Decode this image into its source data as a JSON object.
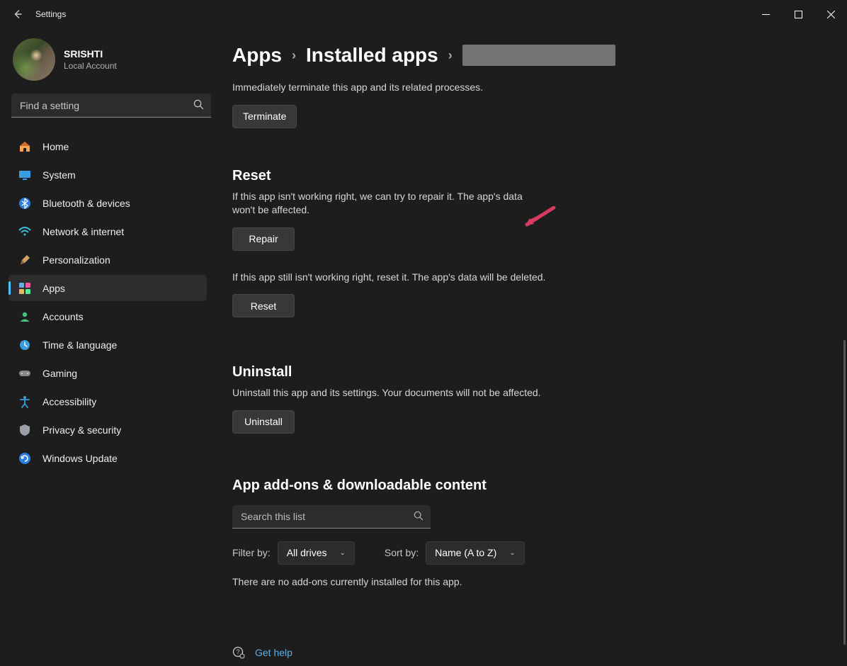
{
  "window": {
    "title": "Settings"
  },
  "profile": {
    "name": "SRISHTI",
    "account_type": "Local Account"
  },
  "search": {
    "placeholder": "Find a setting"
  },
  "nav": {
    "home": "Home",
    "system": "System",
    "bluetooth": "Bluetooth & devices",
    "network": "Network & internet",
    "personalization": "Personalization",
    "apps": "Apps",
    "accounts": "Accounts",
    "time": "Time & language",
    "gaming": "Gaming",
    "accessibility": "Accessibility",
    "privacy": "Privacy & security",
    "update": "Windows Update"
  },
  "breadcrumb": {
    "root": "Apps",
    "child": "Installed apps"
  },
  "terminate": {
    "desc": "Immediately terminate this app and its related processes.",
    "btn": "Terminate"
  },
  "reset": {
    "heading": "Reset",
    "desc1": "If this app isn't working right, we can try to repair it. The app's data won't be affected.",
    "btn1": "Repair",
    "desc2": "If this app still isn't working right, reset it. The app's data will be deleted.",
    "btn2": "Reset"
  },
  "uninstall": {
    "heading": "Uninstall",
    "desc": "Uninstall this app and its settings. Your documents will not be affected.",
    "btn": "Uninstall"
  },
  "addons": {
    "heading": "App add-ons & downloadable content",
    "search_placeholder": "Search this list",
    "filter_label": "Filter by:",
    "filter_value": "All drives",
    "sort_label": "Sort by:",
    "sort_value": "Name (A to Z)",
    "empty": "There are no add-ons currently installed for this app."
  },
  "help": {
    "label": "Get help"
  }
}
